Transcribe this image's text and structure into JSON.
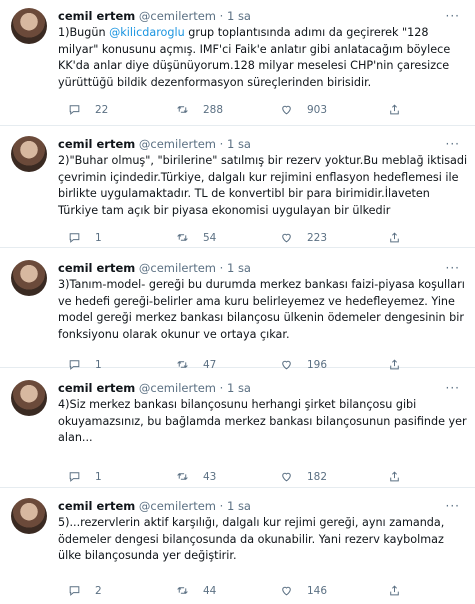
{
  "tweets": [
    {
      "name": "cemil ertem",
      "handle": "@cemilertem",
      "time": "1 sa",
      "text_pre": "1)Bugün ",
      "mention": "@kilicdaroglu",
      "text_post": " grup toplantısında adımı da geçirerek \"128 milyar\" konusunu açmış. IMF'ci Faik'e anlatır gibi anlatacağım böylece KK'da anlar diye düşünüyorum.128 milyar meselesi CHP'nin çaresizce yürüttüğü bildik dezenformasyon süreçlerinden birisidir.",
      "replies": "22",
      "retweets": "288",
      "likes": "903"
    },
    {
      "name": "cemil ertem",
      "handle": "@cemilertem",
      "time": "1 sa",
      "text": "2)\"Buhar olmuş\", \"birilerine\" satılmış bir rezerv yoktur.Bu meblağ iktisadi çevrimin içindedir.Türkiye, dalgalı kur rejimini enflasyon hedeflemesi ile birlikte uygulamaktadır. TL de konvertibl bir para birimidir.İlaveten Türkiye tam açık bir piyasa ekonomisi uygulayan bir ülkedir",
      "replies": "1",
      "retweets": "54",
      "likes": "223"
    },
    {
      "name": "cemil ertem",
      "handle": "@cemilertem",
      "time": "1 sa",
      "text": "3)Tanım-model- gereği bu durumda merkez bankası faizi-piyasa koşulları ve hedefi gereği-belirler ama kuru belirleyemez ve hedefleyemez. Yine model gereği merkez bankası bilançosu ülkenin ödemeler dengesinin bir fonksiyonu olarak okunur ve ortaya çıkar.",
      "replies": "1",
      "retweets": "47",
      "likes": "196"
    },
    {
      "name": "cemil ertem",
      "handle": "@cemilertem",
      "time": "1 sa",
      "text": "4)Siz merkez bankası bilançosunu herhangi şirket bilançosu gibi okuyamazsınız, bu bağlamda merkez bankası bilançosunun pasifinde yer alan...",
      "replies": "1",
      "retweets": "43",
      "likes": "182"
    },
    {
      "name": "cemil ertem",
      "handle": "@cemilertem",
      "time": "1 sa",
      "text": "5)...rezervlerin aktif karşılığı, dalgalı kur rejimi gereği, aynı zamanda, ödemeler dengesi bilançosunda da okunabilir. Yani rezerv kaybolmaz ülke bilançosunda yer değiştirir.",
      "replies": "2",
      "retweets": "44",
      "likes": "146"
    }
  ],
  "colors": {
    "accent": "#1b95e0",
    "muted": "#5b7083",
    "text": "#0f1419",
    "divider": "#e6ecf0"
  },
  "icons": [
    "reply-icon",
    "retweet-icon",
    "like-icon",
    "share-icon",
    "more-icon"
  ]
}
